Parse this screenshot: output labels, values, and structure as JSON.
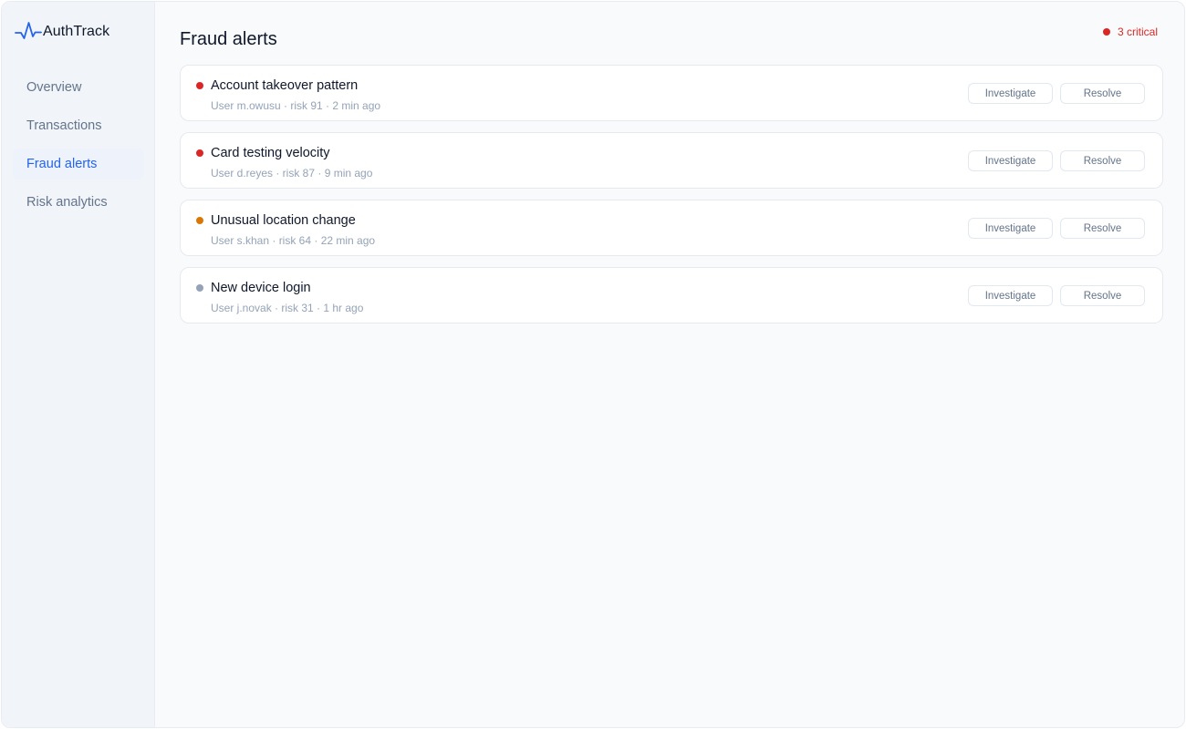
{
  "brand": {
    "name": "AuthTrack",
    "icon": "pulse-icon",
    "accent": "#2563eb"
  },
  "sidebar": {
    "items": [
      {
        "label": "Overview",
        "active": false
      },
      {
        "label": "Transactions",
        "active": false
      },
      {
        "label": "Fraud alerts",
        "active": true
      },
      {
        "label": "Risk analytics",
        "active": false
      }
    ]
  },
  "header": {
    "title": "Fraud alerts",
    "critical_badge": "3 critical",
    "critical_color": "#dc2626"
  },
  "alerts": [
    {
      "title": "Account takeover pattern",
      "meta": "User m.owusu · risk 91 · 2 min ago",
      "severity_color": "#dc2626",
      "investigate_label": "Investigate",
      "resolve_label": "Resolve"
    },
    {
      "title": "Card testing velocity",
      "meta": "User d.reyes · risk 87 · 9 min ago",
      "severity_color": "#dc2626",
      "investigate_label": "Investigate",
      "resolve_label": "Resolve"
    },
    {
      "title": "Unusual location change",
      "meta": "User s.khan · risk 64 · 22 min ago",
      "severity_color": "#d97706",
      "investigate_label": "Investigate",
      "resolve_label": "Resolve"
    },
    {
      "title": "New device login",
      "meta": "User j.novak · risk 31 · 1 hr ago",
      "severity_color": "#94a3b8",
      "investigate_label": "Investigate",
      "resolve_label": "Resolve"
    }
  ]
}
